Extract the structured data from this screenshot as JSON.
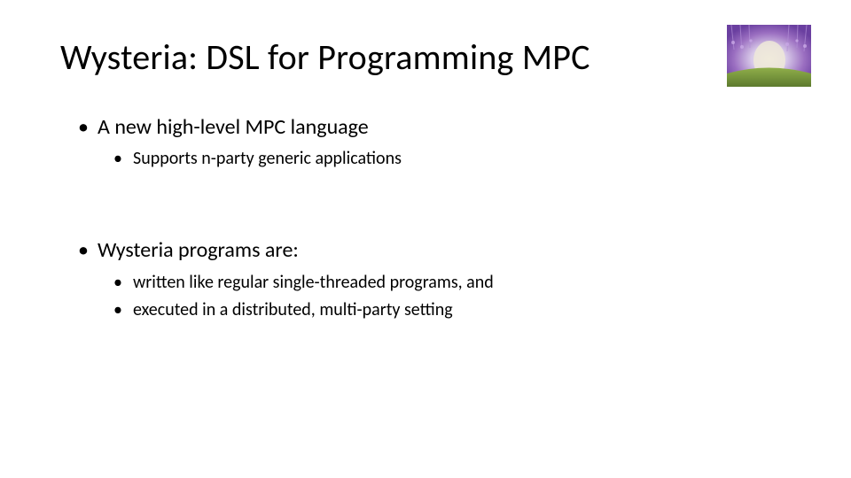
{
  "slide": {
    "title": "Wysteria: DSL for Programming MPC",
    "image_alt": "wisteria-flowers-photo",
    "bullets": {
      "b1": "A new high-level MPC language",
      "b1_children": {
        "c1": "Supports n-party generic applications"
      },
      "b2": "Wysteria programs are:",
      "b2_children": {
        "c1": "written like regular single-threaded programs, and",
        "c2": "executed in a distributed, multi-party setting"
      }
    }
  }
}
